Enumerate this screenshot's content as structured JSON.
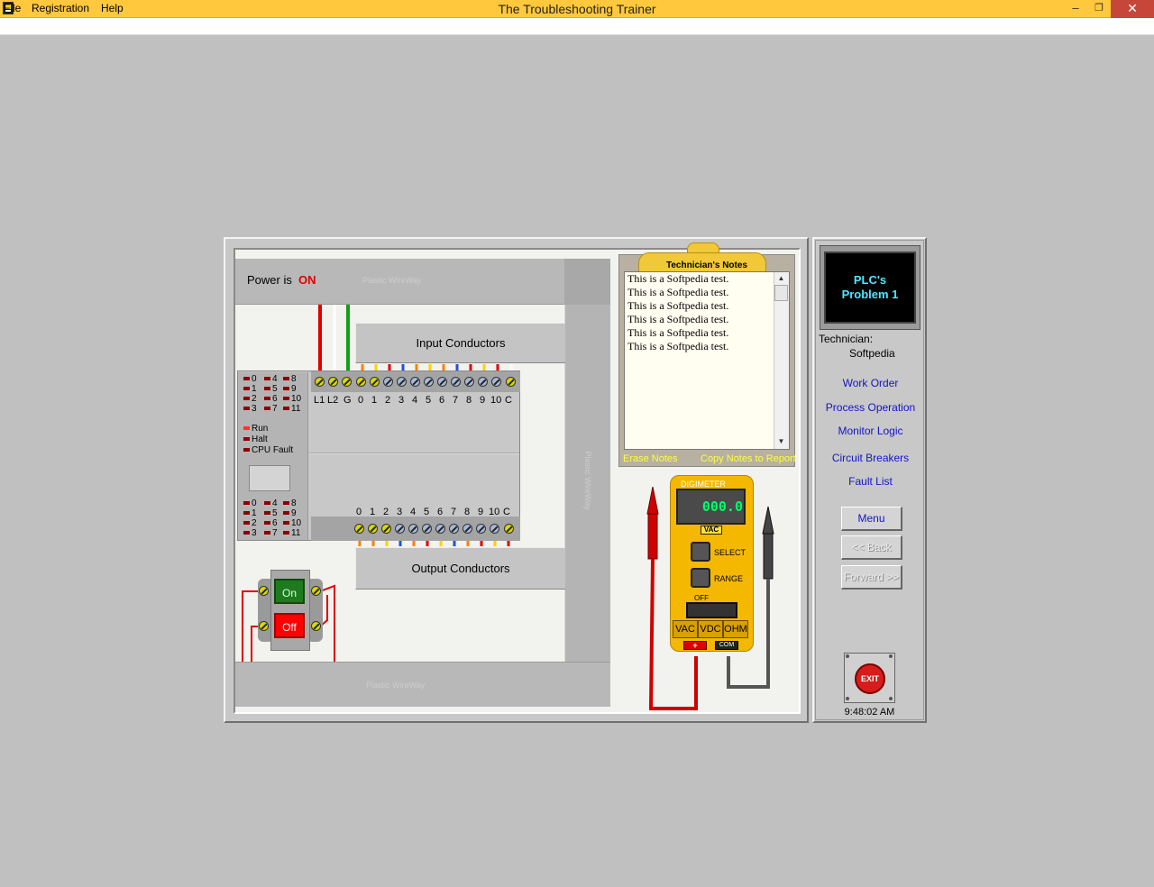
{
  "window": {
    "title": "The Troubleshooting Trainer",
    "minimize_glyph": "–",
    "maximize_glyph": "❐",
    "close_glyph": "✕"
  },
  "menu": {
    "file": "File",
    "registration": "Registration",
    "help": "Help"
  },
  "panel": {
    "power_label": "Power is",
    "power_state": "ON",
    "wireway_label": "Plastic WireWay",
    "input_conductors": "Input Conductors",
    "output_conductors": "Output Conductors"
  },
  "plc": {
    "input_leds": [
      "0",
      "1",
      "2",
      "3",
      "4",
      "5",
      "6",
      "7",
      "8",
      "9",
      "10",
      "11"
    ],
    "output_leds": [
      "0",
      "1",
      "2",
      "3",
      "4",
      "5",
      "6",
      "7",
      "8",
      "9",
      "10",
      "11"
    ],
    "status_leds": [
      "Run",
      "Halt",
      "CPU Fault"
    ],
    "input_terminals": [
      "L1",
      "L2",
      "G",
      "0",
      "1",
      "2",
      "3",
      "4",
      "5",
      "6",
      "7",
      "8",
      "9",
      "10",
      "C"
    ],
    "output_terminals": [
      "0",
      "1",
      "2",
      "3",
      "4",
      "5",
      "6",
      "7",
      "8",
      "9",
      "10",
      "C"
    ]
  },
  "switch_station": {
    "on_label": "On",
    "off_label": "Off"
  },
  "notes": {
    "title": "Technician's Notes",
    "text": "This is a Softpedia test.\nThis is a Softpedia test.\nThis is a Softpedia test.\nThis is a Softpedia test.\nThis is a Softpedia test.\nThis is a Softpedia test.",
    "erase_label": "Erase Notes",
    "copy_label": "Copy Notes to Report"
  },
  "meter": {
    "title": "DIGIMETER",
    "reading": "000.0",
    "mode": "VAC",
    "select_label": "SELECT",
    "range_label": "RANGE",
    "off_label": "OFF",
    "vac_label": "VAC",
    "vdc_label": "VDC",
    "ohm_label": "OHM",
    "plus_jack": "+",
    "com_jack": "COM"
  },
  "nav": {
    "problem_line1": "PLC's",
    "problem_line2": "Problem 1",
    "technician_label": "Technician:",
    "technician_name": "Softpedia",
    "work_order": "Work Order",
    "process_operation": "Process Operation",
    "monitor_logic": "Monitor Logic",
    "circuit_breakers": "Circuit Breakers",
    "fault_list": "Fault List",
    "menu_button": "Menu",
    "back_button": "<< Back",
    "forward_button": "Forward >>",
    "exit_button": "EXIT",
    "clock": "9:48:02 AM"
  },
  "colors": {
    "title_bar": "#ffc83d",
    "power_on": "#e00000",
    "link": "#1414c8",
    "meter_body": "#f5b800",
    "meter_digits": "#00ff66",
    "problem_text": "#4be8ff"
  }
}
